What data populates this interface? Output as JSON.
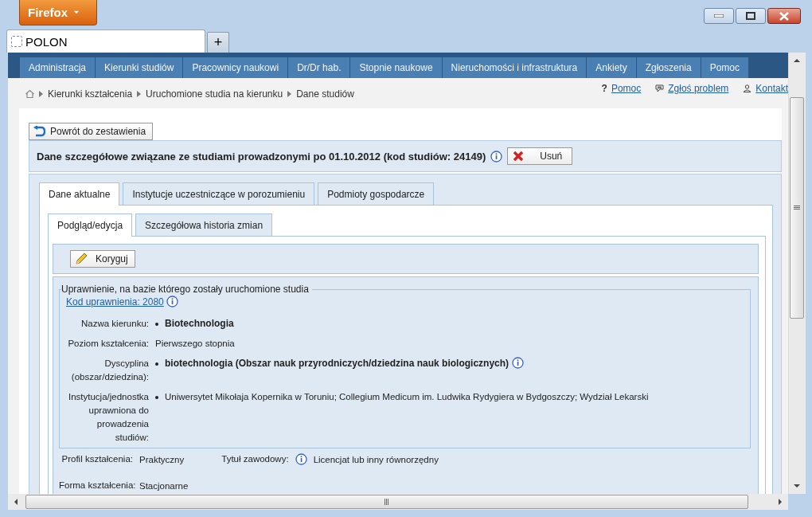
{
  "browser": {
    "menu_button": "Firefox",
    "tab_title": "POLON",
    "new_tab": "+"
  },
  "nav": {
    "items": [
      "Administracja",
      "Kierunki studiów",
      "Pracownicy naukowi",
      "Dr/Dr hab.",
      "Stopnie naukowe",
      "Nieruchomości i infrastruktura",
      "Ankiety",
      "Zgłoszenia",
      "Pomoc"
    ]
  },
  "breadcrumb": [
    "Kierunki kształcenia",
    "Uruchomione studia na kierunku",
    "Dane studiów"
  ],
  "top_links": [
    {
      "kind": "help",
      "mark": "?",
      "label": "Pomoc"
    },
    {
      "kind": "report",
      "label": "Zgłoś problem"
    },
    {
      "kind": "contact",
      "label": "Kontakt"
    }
  ],
  "back_button": "Powrót do zestawienia",
  "header": {
    "title": "Dane szczegółowe związane ze studiami prowadzonymi po 01.10.2012 (kod studiów: 24149)",
    "delete_button": "Usuń"
  },
  "tabs": [
    {
      "label": "Dane aktualne",
      "selected": true
    },
    {
      "label": "Instytucje uczestniczące w porozumieniu",
      "selected": false
    },
    {
      "label": "Podmioty gospodarcze",
      "selected": false
    }
  ],
  "subtabs": [
    {
      "label": "Podgląd/edycja",
      "selected": true
    },
    {
      "label": "Szczegółowa historia zmian",
      "selected": false
    }
  ],
  "edit_button": "Koryguj",
  "authorization": {
    "legend": "Uprawnienie, na bazie którego zostały uruchomione studia",
    "code_link": "Kod uprawnienia: 2080",
    "fields": [
      {
        "label": "Nazwa kierunku:",
        "value": "Biotechnologia",
        "bullet": true,
        "bold": true,
        "info": false
      },
      {
        "label": "Poziom kształcenia:",
        "value": "Pierwszego stopnia",
        "bullet": false,
        "bold": false,
        "info": false
      },
      {
        "label": "Dyscyplina (obszar/dziedzina):",
        "value": "biotechnologia (Obszar nauk przyrodniczych/dziedzina nauk biologicznych)",
        "bullet": true,
        "bold": true,
        "info": true
      },
      {
        "label": "Instytucja/jednostka uprawniona do prowadzenia studiów:",
        "value": "Uniwersytet Mikołaja Kopernika w Toruniu; Collegium Medicum im. Ludwika Rydygiera w Bydgoszczy; Wydział Lekarski",
        "bullet": true,
        "bold": false,
        "info": false
      }
    ]
  },
  "study_rows": [
    [
      {
        "label": "Profil kształcenia:",
        "value": "Praktyczny",
        "info": false
      },
      {
        "label": "Tytuł zawodowy:",
        "value": "Licencjat lub inny równorzędny",
        "info": true
      }
    ],
    [
      {
        "label": "Forma kształcenia:",
        "value": "Stacjonarne",
        "info": false
      }
    ]
  ]
}
